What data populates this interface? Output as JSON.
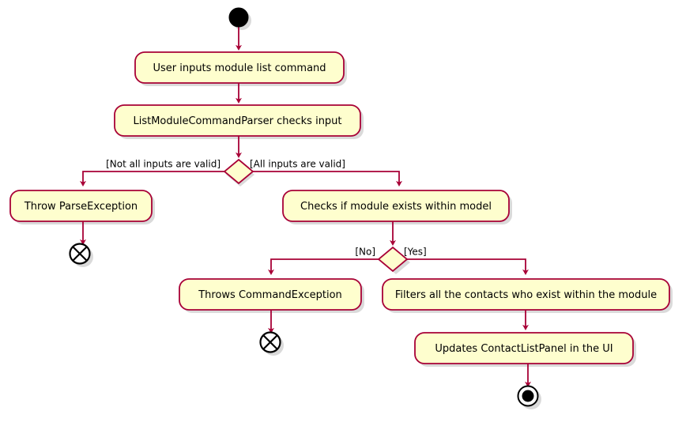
{
  "diagram": {
    "type": "uml-activity-diagram",
    "title": "List Module Command Activity Diagram",
    "style": {
      "node_fill": "#FEFECE",
      "node_border": "#A80036",
      "edge_color": "#A80036",
      "text_color": "#000000",
      "shadow_color": "#B0B0B0",
      "background": "#FFFFFF",
      "terminal_fill": "#000000",
      "terminal_stroke": "#000000"
    },
    "nodes": {
      "start": {
        "kind": "initial-node",
        "label": ""
      },
      "a1": {
        "kind": "action",
        "label": "User inputs module list command"
      },
      "a2": {
        "kind": "action",
        "label": "ListModuleCommandParser checks input"
      },
      "d1": {
        "kind": "decision",
        "label": ""
      },
      "a3": {
        "kind": "action",
        "label": "Throw ParseException"
      },
      "a4": {
        "kind": "action",
        "label": "Checks if module exists within model"
      },
      "end1": {
        "kind": "flow-final-node",
        "label": ""
      },
      "d2": {
        "kind": "decision",
        "label": ""
      },
      "a5": {
        "kind": "action",
        "label": "Throws CommandException"
      },
      "a6": {
        "kind": "action",
        "label": "Filters all the contacts who exist within the module"
      },
      "end2": {
        "kind": "flow-final-node",
        "label": ""
      },
      "a7": {
        "kind": "action",
        "label": "Updates ContactListPanel in the UI"
      },
      "end3": {
        "kind": "activity-final-node",
        "label": ""
      }
    },
    "edge_labels": {
      "d1_left": "[Not all inputs are valid]",
      "d1_right": "[All inputs are valid]",
      "d2_left": "[No]",
      "d2_right": "[Yes]"
    }
  }
}
